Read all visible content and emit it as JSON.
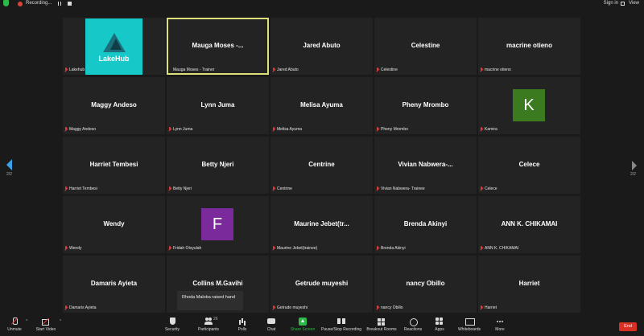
{
  "topbar": {
    "recording_label": "Recording...",
    "signin": "Sign in",
    "view": "View"
  },
  "paging": {
    "left": "2/2",
    "right": "2/2"
  },
  "tiles": [
    {
      "name": "",
      "label": "Lakehub",
      "logo_text": "LakeHub"
    },
    {
      "name": "Mauga Moses -...",
      "label": "Mauga Moses - Trainer"
    },
    {
      "name": "Jared Abuto",
      "label": "Jared Abuto"
    },
    {
      "name": "Celestine",
      "label": "Celestine"
    },
    {
      "name": "macrine otieno",
      "label": "macrine otieno"
    },
    {
      "name": "Maggy Andeso",
      "label": "Maggy Andeso"
    },
    {
      "name": "Lynn Juma",
      "label": "Lynn Juma"
    },
    {
      "name": "Melisa Ayuma",
      "label": "Melisa Ayuma"
    },
    {
      "name": "Pheny Mrombo",
      "label": "Pheny Mrombo"
    },
    {
      "name": "",
      "label": "Kamira",
      "avatar": "K"
    },
    {
      "name": "Harriet Tembesi",
      "label": "Harriet Tembesi"
    },
    {
      "name": "Betty Njeri",
      "label": "Betty Njeri"
    },
    {
      "name": "Centrine",
      "label": "Centrine"
    },
    {
      "name": "Vivian Nabwera-...",
      "label": "Vivian Nabwera- Trainee"
    },
    {
      "name": "Celece",
      "label": "Celece"
    },
    {
      "name": "Wendy",
      "label": "Wendy"
    },
    {
      "name": "",
      "label": "Fridah Otsyulah",
      "avatar": "F"
    },
    {
      "name": "Maurine Jebet(tr...",
      "label": "Maurine Jebet(trainee)"
    },
    {
      "name": "Brenda Akinyi",
      "label": "Brenda Akinyi"
    },
    {
      "name": "ANN K. CHIKAMAI",
      "label": "ANN K. CHIKAMAI"
    },
    {
      "name": "Damaris Ayieta",
      "label": "Damaris Ayieta"
    },
    {
      "name": "Collins M.Gavihi",
      "label": ""
    },
    {
      "name": "Getrude muyeshi",
      "label": "Getrude muyeshi"
    },
    {
      "name": "nancy Obillo",
      "label": "nancy Obillo"
    },
    {
      "name": "Harriet",
      "label": "Harriet"
    }
  ],
  "colors": {
    "active_border": "#dde07a",
    "avatar_k": "#3c7a1f",
    "avatar_f": "#7a2a9a",
    "lakehub_bg": "#17c8c8",
    "share_green": "#2db84a",
    "end_red": "#d93025"
  },
  "toast": {
    "text": "Rhoda Maloba raised hand"
  },
  "toolbar": {
    "unmute": "Unmute",
    "start_video": "Start Video",
    "security": "Security",
    "participants": "Participants",
    "participants_count": "26",
    "polls": "Polls",
    "chat": "Chat",
    "share_screen": "Share Screen",
    "record": "Pause/Stop Recording",
    "breakout": "Breakout Rooms",
    "reactions": "Reactions",
    "apps": "Apps",
    "whiteboards": "Whiteboards",
    "more": "More",
    "end": "End"
  }
}
